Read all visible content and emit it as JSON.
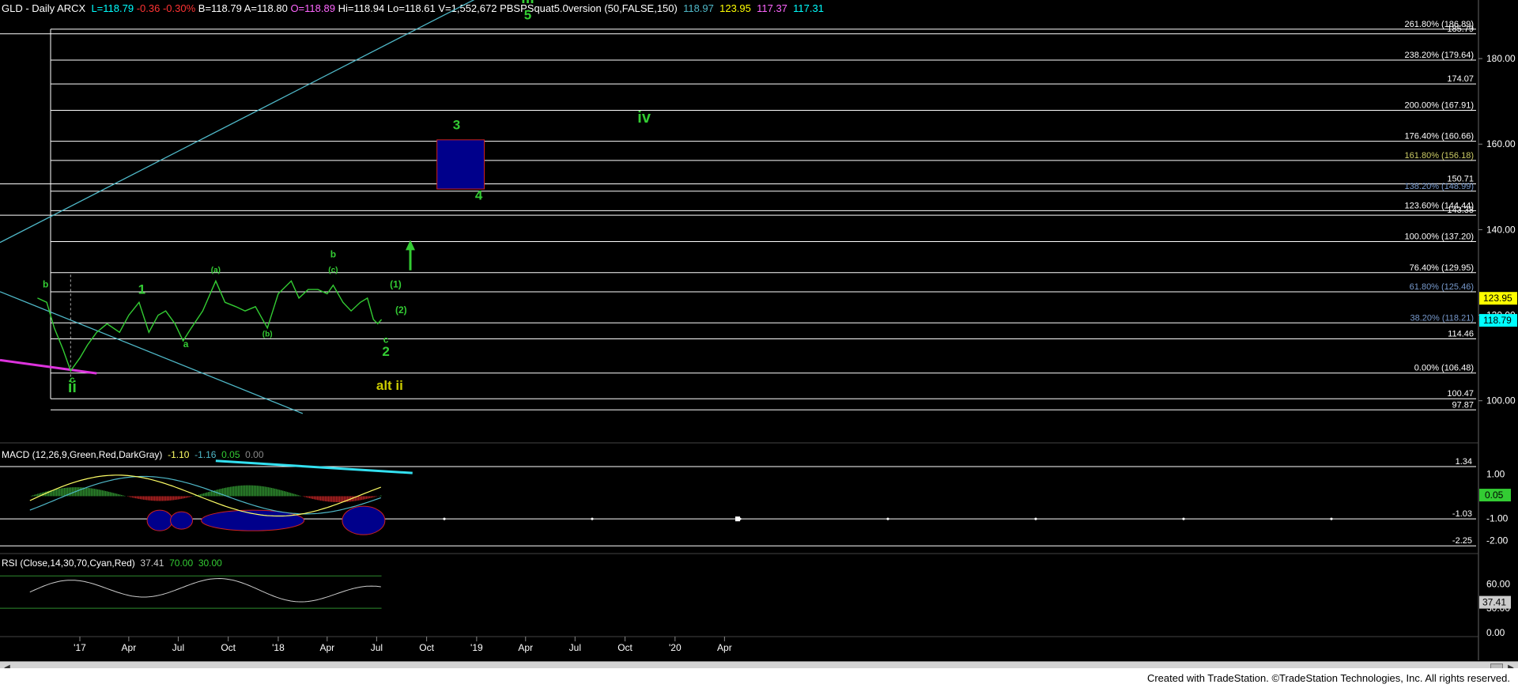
{
  "header": {
    "symbol": "GLD - Daily ARCX",
    "last": "L=118.79",
    "change": "-0.36",
    "pct": "-0.30%",
    "bid": "B=118.79",
    "ask": "A=118.80",
    "open": "O=118.89",
    "high": "Hi=118.94",
    "low": "Lo=118.61",
    "vol": "V=1,552,672",
    "study": "PBSPSquat5.0version (50,FALSE,150)",
    "v1": "118.97",
    "v2": "123.95",
    "v3": "117.37",
    "v4": "117.31"
  },
  "macd_header": {
    "label": "MACD (12,26,9,Green,Red,DarkGray)",
    "v1": "-1.10",
    "v2": "-1.16",
    "v3": "0.05",
    "v4": "0.00"
  },
  "rsi_header": {
    "label": "RSI (Close,14,30,70,Cyan,Red)",
    "v1": "37.41",
    "v2": "70.00",
    "v3": "30.00"
  },
  "footer": {
    "text": "Created with TradeStation. ©TradeStation Technologies, Inc. All rights reserved."
  },
  "chart_data": {
    "type": "line",
    "title": "GLD - Daily ARCX",
    "x_tick_labels": [
      "'17",
      "Apr",
      "Jul",
      "Oct",
      "'18",
      "Apr",
      "Jul",
      "Oct",
      "'19",
      "Apr",
      "Jul",
      "Oct",
      "'20",
      "Apr"
    ],
    "price_axis": {
      "ticks": [
        "180.00",
        "160.00",
        "140.00",
        "120.00",
        "100.00"
      ],
      "ylim": [
        92,
        190
      ]
    },
    "price_series_xy": [
      [
        "2016-10-15",
        124
      ],
      [
        "2016-11-01",
        123
      ],
      [
        "2016-11-15",
        117
      ],
      [
        "2016-12-01",
        112
      ],
      [
        "2016-12-15",
        107
      ],
      [
        "2017-01-01",
        110
      ],
      [
        "2017-01-15",
        113
      ],
      [
        "2017-02-01",
        116
      ],
      [
        "2017-02-20",
        118
      ],
      [
        "2017-03-15",
        116
      ],
      [
        "2017-04-01",
        120
      ],
      [
        "2017-04-20",
        123
      ],
      [
        "2017-05-08",
        116
      ],
      [
        "2017-05-25",
        120
      ],
      [
        "2017-06-08",
        121
      ],
      [
        "2017-06-25",
        118
      ],
      [
        "2017-07-10",
        114
      ],
      [
        "2017-07-25",
        117
      ],
      [
        "2017-08-15",
        121
      ],
      [
        "2017-09-08",
        128
      ],
      [
        "2017-09-25",
        123
      ],
      [
        "2017-10-15",
        122
      ],
      [
        "2017-11-01",
        121
      ],
      [
        "2017-11-20",
        122
      ],
      [
        "2017-12-12",
        117
      ],
      [
        "2018-01-01",
        125
      ],
      [
        "2018-01-25",
        128
      ],
      [
        "2018-02-08",
        124
      ],
      [
        "2018-02-25",
        126
      ],
      [
        "2018-03-15",
        126
      ],
      [
        "2018-04-01",
        125
      ],
      [
        "2018-04-12",
        127
      ],
      [
        "2018-04-30",
        123
      ],
      [
        "2018-05-15",
        121
      ],
      [
        "2018-06-01",
        123
      ],
      [
        "2018-06-14",
        124
      ],
      [
        "2018-06-25",
        119
      ],
      [
        "2018-07-03",
        118
      ],
      [
        "2018-07-10",
        119
      ]
    ],
    "horizontal_levels": [
      {
        "label": "261.80% (186.89)",
        "value": 186.89
      },
      {
        "label": "185.79",
        "value": 185.79
      },
      {
        "label": "238.20% (179.64)",
        "value": 179.64
      },
      {
        "label": "174.07",
        "value": 174.07
      },
      {
        "label": "200.00% (167.91)",
        "value": 167.91
      },
      {
        "label": "176.40% (160.66)",
        "value": 160.66
      },
      {
        "label": "161.80% (156.18)",
        "value": 156.18
      },
      {
        "label": "150.71",
        "value": 150.71
      },
      {
        "label": "138.20% (148.99)",
        "value": 148.99
      },
      {
        "label": "123.60% (144.44)",
        "value": 144.44
      },
      {
        "label": "143.38",
        "value": 143.38
      },
      {
        "label": "100.00% (137.20)",
        "value": 137.2
      },
      {
        "label": "76.40% (129.95)",
        "value": 129.95
      },
      {
        "label": "61.80% (125.46)",
        "value": 125.46
      },
      {
        "label": "38.20% (118.21)",
        "value": 118.21
      },
      {
        "label": "114.46",
        "value": 114.46
      },
      {
        "label": "0.00% (106.48)",
        "value": 106.48
      },
      {
        "label": "100.47",
        "value": 100.47
      },
      {
        "label": "97.87",
        "value": 97.87
      }
    ],
    "price_tags": [
      {
        "label": "123.95",
        "value": 123.95,
        "color": "#ffff00"
      },
      {
        "label": "118.79",
        "value": 118.79,
        "color": "#00ffff"
      }
    ],
    "target_box": {
      "x1": "2018-10-20",
      "x2": "2019-01-15",
      "y1": 161.0,
      "y2": 149.5
    },
    "wave_labels": [
      {
        "text": "b",
        "x": "2016-10-30",
        "y": 126.5,
        "color": "#33cc33",
        "size": "small"
      },
      {
        "text": "c",
        "x": "2016-12-18",
        "y": 104.2,
        "color": "#33cc33",
        "size": "small"
      },
      {
        "text": "ii",
        "x": "2016-12-18",
        "y": 102,
        "color": "#33cc33",
        "size": "big"
      },
      {
        "text": "1",
        "x": "2017-04-25",
        "y": 125,
        "color": "#33cc33",
        "size": "med"
      },
      {
        "text": "a",
        "x": "2017-07-15",
        "y": 112.5,
        "color": "#33cc33",
        "size": "small"
      },
      {
        "text": "(a)",
        "x": "2017-09-08",
        "y": 130,
        "color": "#33cc33",
        "size": "tiny"
      },
      {
        "text": "(b)",
        "x": "2017-12-12",
        "y": 115,
        "color": "#33cc33",
        "size": "tiny"
      },
      {
        "text": "b",
        "x": "2018-04-12",
        "y": 133.5,
        "color": "#33cc33",
        "size": "small"
      },
      {
        "text": "(c)",
        "x": "2018-04-12",
        "y": 130,
        "color": "#33cc33",
        "size": "tiny"
      },
      {
        "text": "c",
        "x": "2018-07-18",
        "y": 113.5,
        "color": "#33cc33",
        "size": "small"
      },
      {
        "text": "2",
        "x": "2018-07-18",
        "y": 110.5,
        "color": "#33cc33",
        "size": "med"
      },
      {
        "text": "(1)",
        "x": "2018-08-05",
        "y": 126.5,
        "color": "#33cc33",
        "size": "small"
      },
      {
        "text": "(2)",
        "x": "2018-08-15",
        "y": 120.5,
        "color": "#33cc33",
        "size": "small"
      },
      {
        "text": "alt ii",
        "x": "2018-07-25",
        "y": 102.5,
        "color": "#cccc00",
        "size": "med"
      },
      {
        "text": "3",
        "x": "2018-11-25",
        "y": 163.5,
        "color": "#33cc33",
        "size": "med"
      },
      {
        "text": "4",
        "x": "2019-01-05",
        "y": 147,
        "color": "#33cc33",
        "size": "med"
      },
      {
        "text": "iii",
        "x": "2019-04-05",
        "y": 193,
        "color": "#33cc33",
        "size": "big"
      },
      {
        "text": "5",
        "x": "2019-04-05",
        "y": 189.2,
        "color": "#33cc33",
        "size": "med"
      },
      {
        "text": "iv",
        "x": "2019-11-05",
        "y": 165,
        "color": "#33cc33",
        "size": "big"
      }
    ],
    "macd_axis": {
      "ticks": [
        "1.00",
        "-1.00",
        "-2.00"
      ],
      "ylim": [
        -2.6,
        1.7
      ]
    },
    "macd_levels": [
      {
        "label": "1.34",
        "value": 1.34
      },
      {
        "label": "-1.03",
        "value": -1.03
      },
      {
        "label": "-2.25",
        "value": -2.25
      }
    ],
    "macd_last": {
      "label": "0.05",
      "value": 0.05
    },
    "rsi_axis": {
      "ticks": [
        "60.00",
        "30.00",
        "0.00"
      ],
      "ylim": [
        -5,
        80
      ]
    },
    "rsi_last": {
      "label": "37.41",
      "value": 37.41
    },
    "colors": {
      "price": "#33cc33",
      "level": "#ffffff",
      "trendline": "#4fb8c8",
      "magenta": "#dd33dd",
      "box": "#00008b",
      "macd_line": "#ffff66",
      "signal_line": "#4fb8c8",
      "hist_pos": "#2e8b2e",
      "hist_neg": "#b22222",
      "rsi_line": "#cccccc",
      "arrow": "#33cc33"
    }
  }
}
